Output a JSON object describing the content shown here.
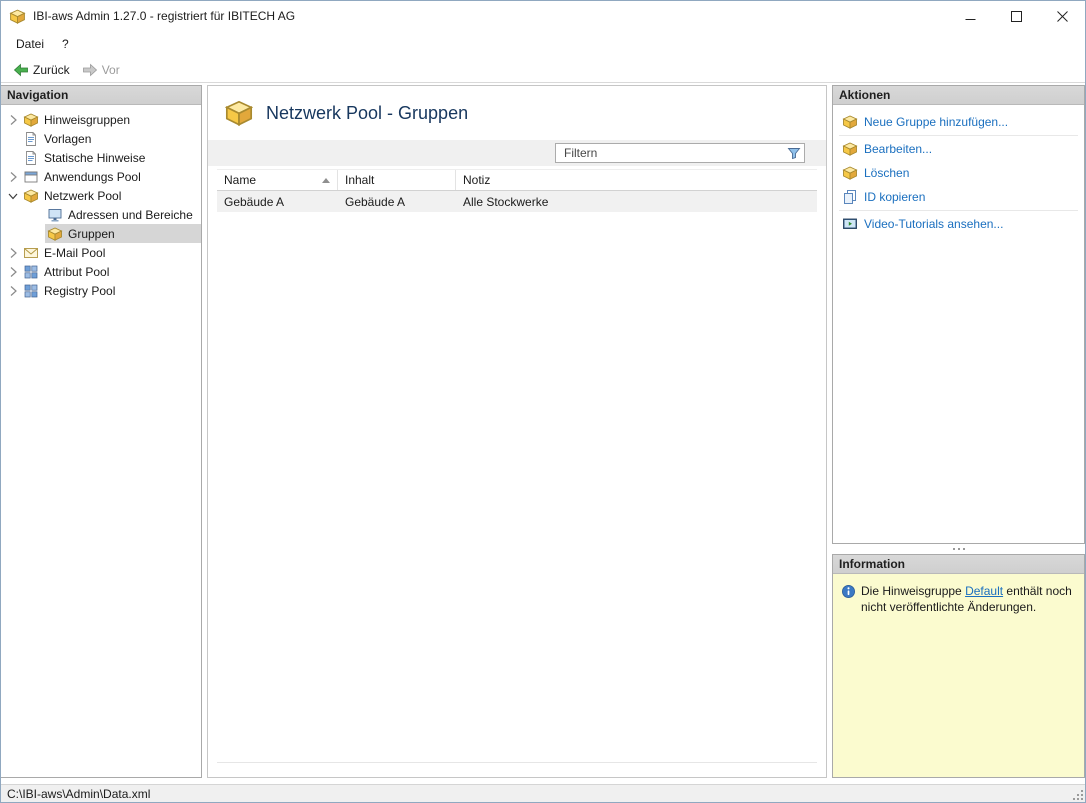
{
  "window": {
    "title": "IBI-aws Admin 1.27.0 - registriert für IBITECH AG"
  },
  "menu": {
    "items": [
      {
        "label": "Datei"
      },
      {
        "label": "?"
      }
    ]
  },
  "toolbar": {
    "back_label": "Zurück",
    "forward_label": "Vor"
  },
  "navigation": {
    "header": "Navigation",
    "items": [
      {
        "label": "Hinweisgruppen",
        "icon": "notice-groups-icon",
        "state": "collapsed",
        "level": 0,
        "selected": false
      },
      {
        "label": "Vorlagen",
        "icon": "templates-icon",
        "state": "leaf",
        "level": 0,
        "selected": false
      },
      {
        "label": "Statische Hinweise",
        "icon": "static-notices-icon",
        "state": "leaf",
        "level": 0,
        "selected": false
      },
      {
        "label": "Anwendungs Pool",
        "icon": "application-pool-icon",
        "state": "collapsed",
        "level": 0,
        "selected": false
      },
      {
        "label": "Netzwerk Pool",
        "icon": "network-pool-icon",
        "state": "expanded",
        "level": 0,
        "selected": false
      },
      {
        "label": "Adressen und Bereiche",
        "icon": "addresses-ranges-icon",
        "state": "leaf",
        "level": 1,
        "selected": false
      },
      {
        "label": "Gruppen",
        "icon": "groups-icon",
        "state": "leaf",
        "level": 1,
        "selected": true
      },
      {
        "label": "E-Mail Pool",
        "icon": "email-pool-icon",
        "state": "collapsed",
        "level": 0,
        "selected": false
      },
      {
        "label": "Attribut Pool",
        "icon": "attribute-pool-icon",
        "state": "collapsed",
        "level": 0,
        "selected": false
      },
      {
        "label": "Registry Pool",
        "icon": "registry-pool-icon",
        "state": "collapsed",
        "level": 0,
        "selected": false
      }
    ]
  },
  "main": {
    "title": "Netzwerk Pool - Gruppen",
    "filter_placeholder": "Filtern",
    "table": {
      "columns": [
        "Name",
        "Inhalt",
        "Notiz"
      ],
      "sort": {
        "column": "Name",
        "direction": "asc"
      },
      "rows": [
        {
          "name": "Gebäude A",
          "inhalt": "Gebäude A",
          "notiz": "Alle Stockwerke"
        }
      ]
    }
  },
  "actions": {
    "header": "Aktionen",
    "items": [
      {
        "label": "Neue Gruppe hinzufügen...",
        "icon": "new-group-icon"
      },
      {
        "label": "Bearbeiten...",
        "icon": "edit-group-icon"
      },
      {
        "label": "Löschen",
        "icon": "delete-group-icon"
      },
      {
        "label": "ID kopieren",
        "icon": "copy-id-icon"
      },
      {
        "label": "Video-Tutorials ansehen...",
        "icon": "video-tutorials-icon"
      }
    ]
  },
  "information": {
    "header": "Information",
    "text_before": "Die Hinweisgruppe ",
    "link_label": "Default",
    "text_after": " enthält noch nicht veröffentlichte Änderungen."
  },
  "statusbar": {
    "path": "C:\\IBI-aws\\Admin\\Data.xml"
  },
  "colors": {
    "accent_link": "#1a6fbf",
    "info_panel_bg": "#fbfbcf",
    "panel_header_bg": "#d8d8d8",
    "selection_bg": "#d6d6d6",
    "title_text": "#17375e",
    "back_arrow_green": "#49b04f"
  }
}
